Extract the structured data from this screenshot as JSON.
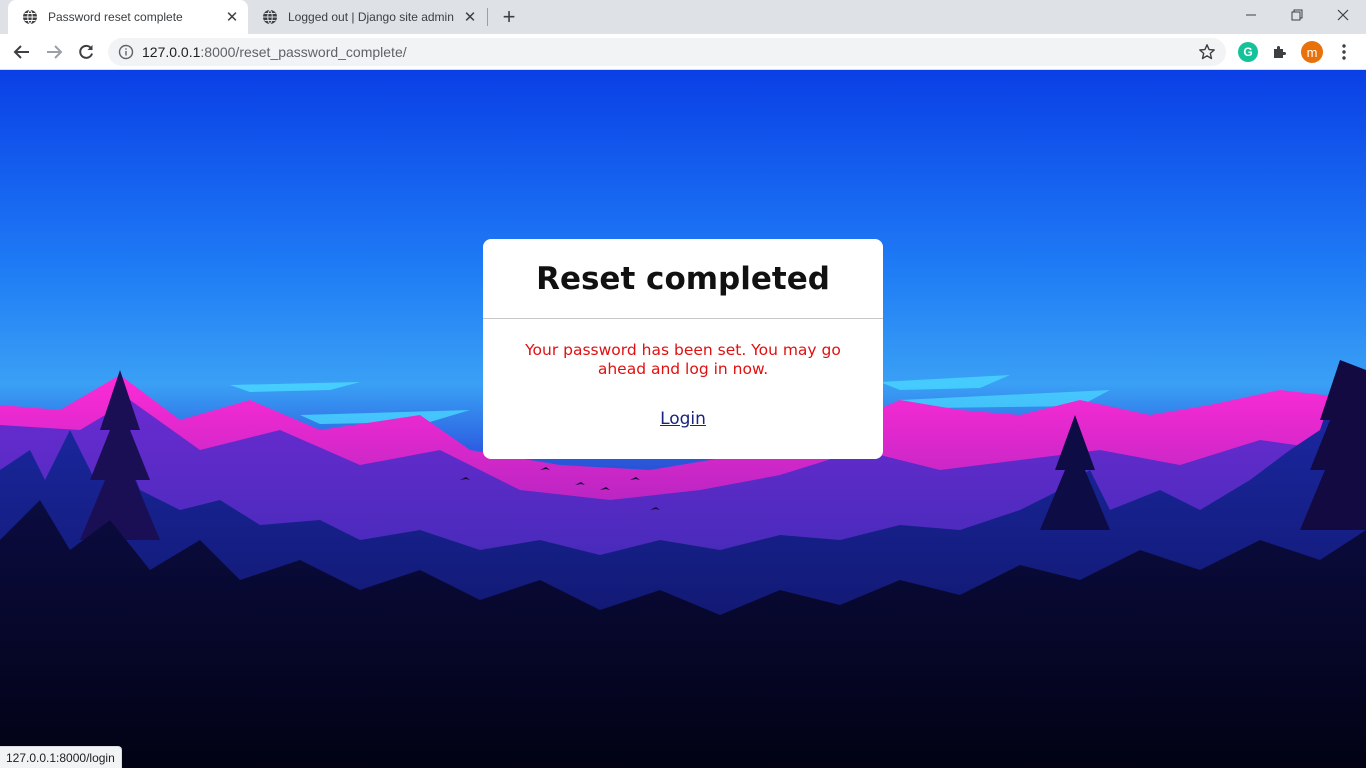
{
  "tabs": [
    {
      "title": "Password reset complete",
      "active": true
    },
    {
      "title": "Logged out | Django site admin",
      "active": false
    }
  ],
  "toolbar": {
    "url_host": "127.0.0.1",
    "url_path": ":8000/reset_password_complete/",
    "profile_initial": "m",
    "grammarly_initial": "G"
  },
  "card": {
    "title": "Reset completed",
    "message": "Your password has been set. You may go ahead and log in now.",
    "link_label": "Login"
  },
  "status_bar": {
    "text": "127.0.0.1:8000/login"
  },
  "colors": {
    "message": "#e01010",
    "link": "#1a237e",
    "profile": "#e8710a",
    "grammarly": "#15c39a"
  }
}
